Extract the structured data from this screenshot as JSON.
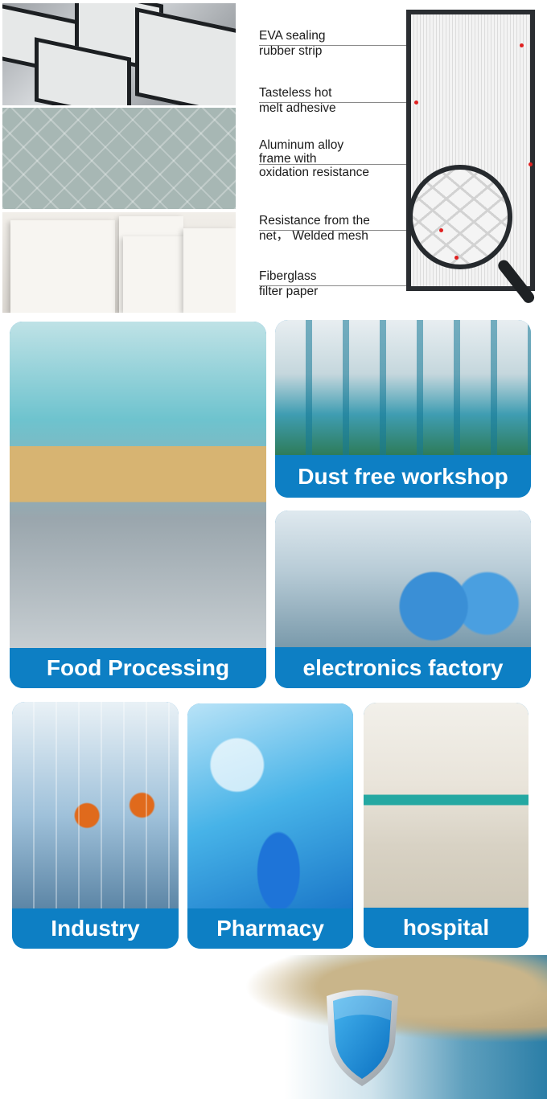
{
  "structure_callouts": [
    {
      "line1": "EVA sealing",
      "line2": "rubber strip"
    },
    {
      "line1": "Tasteless hot",
      "line2": "melt adhesive"
    },
    {
      "line1": "Aluminum alloy",
      "line2": "frame with",
      "line3": "oxidation resistance"
    },
    {
      "line1": "Resistance from the",
      "line2": "net， Welded mesh"
    },
    {
      "line1": "Fiberglass",
      "line2": "filter paper"
    }
  ],
  "applications": {
    "food": "Food Processing",
    "workshop": "Dust free workshop",
    "electronics": "electronics factory",
    "industry": "Industry",
    "pharmacy": "Pharmacy",
    "hospital": "hospital"
  },
  "colors": {
    "banner_blue": "#0d7fc4",
    "callout_pin": "#e02020",
    "frame_dark": "#2a2d31"
  },
  "icons": {
    "shield": "shield-icon",
    "magnifier": "magnifier-icon"
  }
}
